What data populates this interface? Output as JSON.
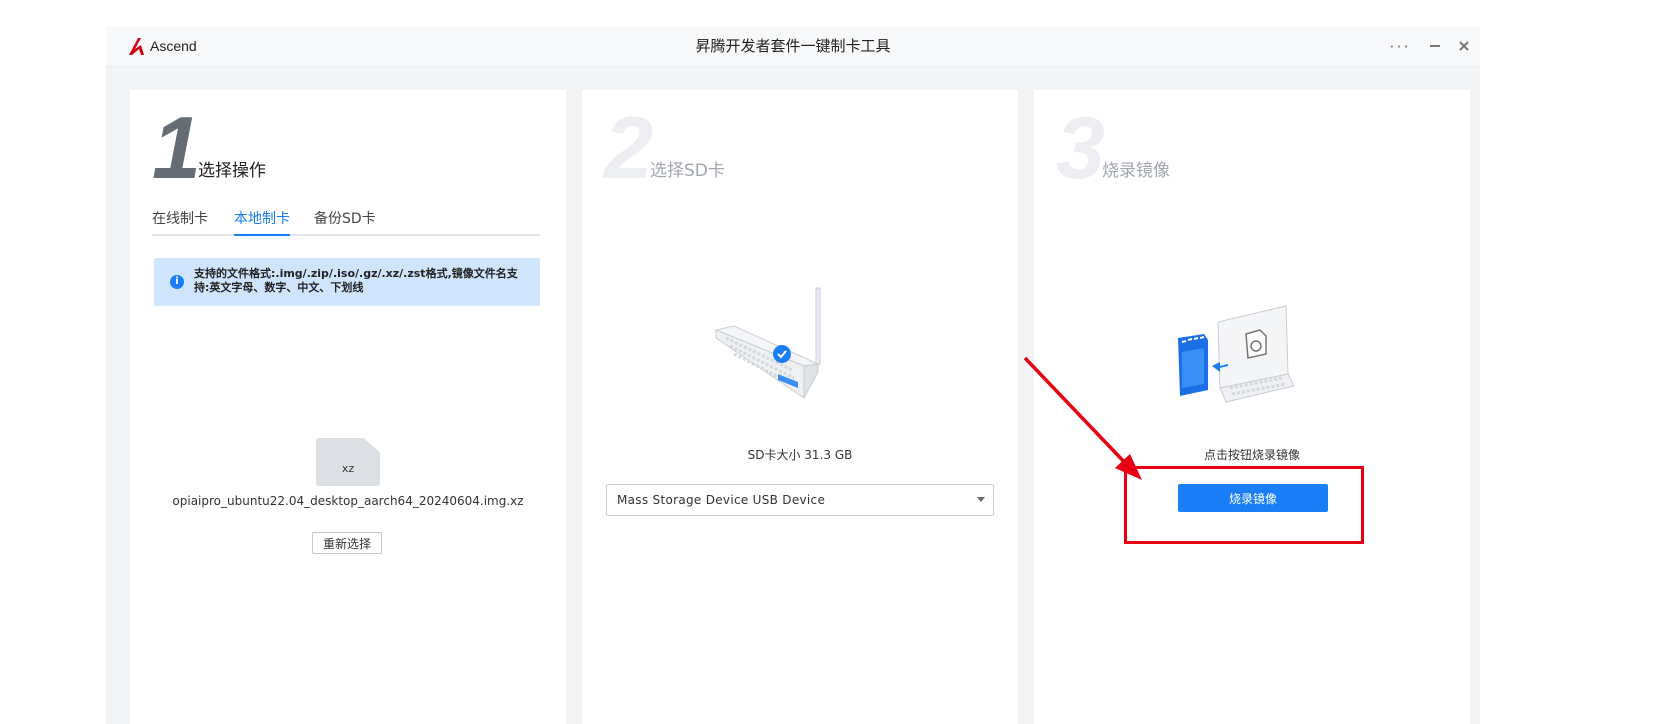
{
  "window": {
    "title": "昇腾开发者套件一键制卡工具",
    "logo_text": "Ascend",
    "controls": {
      "more": "···",
      "minimize": "–",
      "close": "✕"
    }
  },
  "steps": [
    {
      "number": "1",
      "title": "选择操作",
      "tabs": [
        {
          "label": "在线制卡",
          "active": false
        },
        {
          "label": "本地制卡",
          "active": true
        },
        {
          "label": "备份SD卡",
          "active": false
        }
      ],
      "info": {
        "icon": "info-icon",
        "text": "支持的文件格式:.img/.zip/.iso/.gz/.xz/.zst格式,镜像文件名支持:英文字母、数字、中文、下划线"
      },
      "file": {
        "extension": "xz",
        "name": "opiaipro_ubuntu22.04_desktop_aarch64_20240604.img.xz"
      },
      "reselect_label": "重新选择"
    },
    {
      "number": "2",
      "title": "选择SD卡",
      "sd_size": "SD卡大小  31.3  GB",
      "device_select": "Mass Storage Device USB Device"
    },
    {
      "number": "3",
      "title": "烧录镜像",
      "hint": "点击按钮烧录镜像",
      "burn_label": "烧录镜像"
    }
  ],
  "colors": {
    "accent": "#1a7ef7",
    "annotation": "#e60012",
    "info_bg": "#cfe4fd"
  }
}
